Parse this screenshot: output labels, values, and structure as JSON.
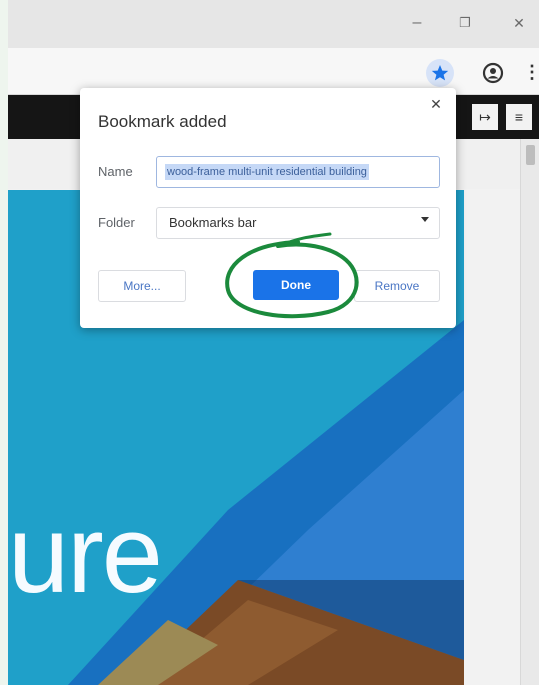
{
  "window": {
    "minimize_glyph": "–",
    "restore_glyph": "❐",
    "close_glyph": "✕"
  },
  "toolbar": {
    "bookmark_star_icon": "star-icon",
    "account_icon": "account-circle-icon",
    "menu_glyph": "⋮"
  },
  "page": {
    "hero_text": "ure",
    "toolbar_icons": [
      "↦",
      "≡"
    ]
  },
  "bookmark_popup": {
    "title": "Bookmark added",
    "close_glyph": "✕",
    "name_label": "Name",
    "name_value": "wood-frame multi-unit residential building",
    "folder_label": "Folder",
    "folder_value": "Bookmarks bar",
    "more_button": "More...",
    "done_button": "Done",
    "remove_button": "Remove"
  },
  "colors": {
    "accent": "#1a73e8",
    "annotation": "#1b8a3c",
    "hero": "#1fa0c9"
  }
}
